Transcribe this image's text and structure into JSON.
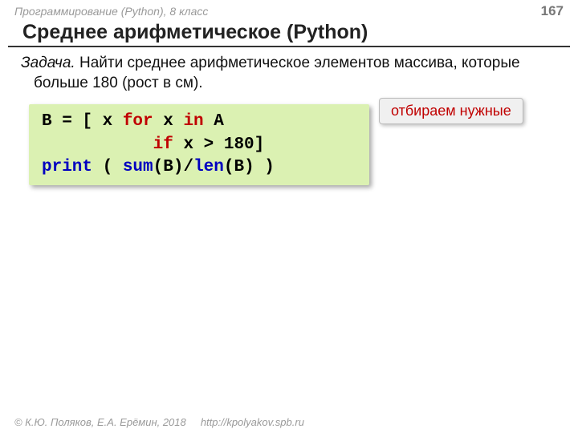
{
  "header": {
    "course": "Программирование (Python), 8 класс",
    "page": "167"
  },
  "title": "Среднее арифметическое (Python)",
  "task": {
    "label": "Задача.",
    "text": " Найти среднее арифметическое элементов массива, которые больше 180 (рост в см)."
  },
  "code": {
    "t1": "B = [ x ",
    "for": "for",
    "t2": " x ",
    "in": "in",
    "t3": " A",
    "line2a": "           ",
    "if": "if",
    "line2b": " x > 180]",
    "print": "print",
    "t4": " ( ",
    "sum": "sum",
    "t5": "(B)/",
    "len": "len",
    "t6": "(B) )"
  },
  "callout": "отбираем нужные",
  "footer": {
    "copyright": "© К.Ю. Поляков, Е.А. Ерёмин, 2018",
    "url": "http://kpolyakov.spb.ru"
  }
}
